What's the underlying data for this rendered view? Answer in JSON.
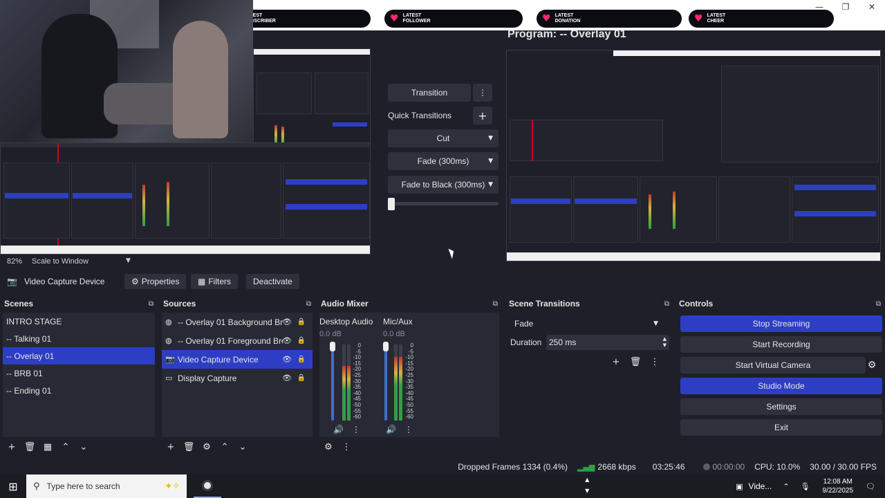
{
  "window": {
    "minimize": "—",
    "maximize": "❐",
    "close": "✕"
  },
  "alerts": [
    {
      "line1": "LATEST",
      "line2": "SUBSCRIBER"
    },
    {
      "line1": "LATEST",
      "line2": "FOLLOWER"
    },
    {
      "line1": "LATEST",
      "line2": "DONATION"
    },
    {
      "line1": "LATEST",
      "line2": "CHEER"
    }
  ],
  "preview": {
    "zoom": "82%",
    "scale_mode": "Scale to Window"
  },
  "program": {
    "title": "Program: -- Overlay 01"
  },
  "transitions": {
    "transition_label": "Transition",
    "quick_label": "Quick Transitions",
    "quick": [
      "Cut",
      "Fade (300ms)",
      "Fade to Black (300ms)"
    ],
    "tbar_position": 0.0
  },
  "context": {
    "source_name": "Video Capture Device",
    "properties": "Properties",
    "filters": "Filters",
    "deactivate": "Deactivate"
  },
  "scenes": {
    "title": "Scenes",
    "items": [
      "INTRO STAGE",
      "-- Talking 01",
      "-- Overlay 01",
      "-- BRB 01",
      "-- Ending 01"
    ],
    "selected_index": 2
  },
  "sources": {
    "title": "Sources",
    "items": [
      {
        "name": "-- Overlay 01  Background Browser",
        "icon": "globe-icon"
      },
      {
        "name": "-- Overlay 01  Foreground Browser",
        "icon": "globe-icon"
      },
      {
        "name": "Video Capture Device",
        "icon": "camera-icon"
      },
      {
        "name": "Display Capture",
        "icon": "monitor-icon"
      }
    ],
    "selected_index": 2
  },
  "mixer": {
    "title": "Audio Mixer",
    "channels": [
      {
        "name": "Desktop Audio",
        "db": "0.0 dB",
        "level": 0.72
      },
      {
        "name": "Mic/Aux",
        "db": "0.0 dB",
        "level": 0.84
      }
    ],
    "scale": [
      "0",
      "-5",
      "-10",
      "-15",
      "-20",
      "-25",
      "-30",
      "-35",
      "-40",
      "-45",
      "-50",
      "-55",
      "-60"
    ]
  },
  "scene_transitions": {
    "title": "Scene Transitions",
    "selected": "Fade",
    "duration_label": "Duration",
    "duration_value": "250 ms"
  },
  "controls": {
    "title": "Controls",
    "stop_streaming": "Stop Streaming",
    "start_recording": "Start Recording",
    "start_virtual_camera": "Start Virtual Camera",
    "studio_mode": "Studio Mode",
    "settings": "Settings",
    "exit": "Exit"
  },
  "status": {
    "dropped_frames": "Dropped Frames 1334 (0.4%)",
    "bitrate": "2668 kbps",
    "stream_time": "03:25:46",
    "record_time": "00:00:00",
    "cpu": "CPU: 10.0%",
    "fps": "30.00 / 30.00 FPS"
  },
  "taskbar": {
    "search_placeholder": "Type here to search",
    "tray_app": "Vide...",
    "time": "12:08 AM",
    "date": "9/22/2025"
  },
  "colors": {
    "accent": "#2d3ec4",
    "background": "#1e1f29",
    "panel": "#272934",
    "alert_heart": "#ff2a6d"
  }
}
